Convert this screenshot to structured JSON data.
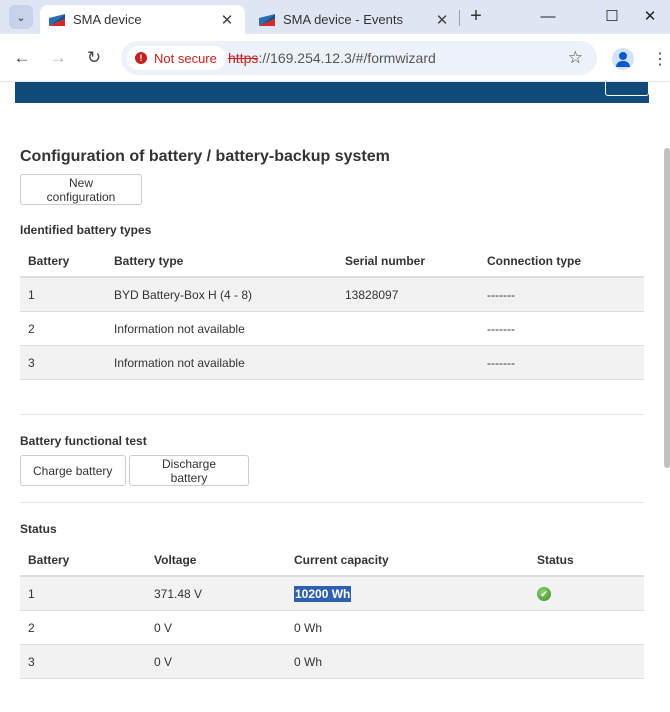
{
  "browser": {
    "tabs": [
      {
        "title": "SMA device",
        "active": true
      },
      {
        "title": "SMA device - Events",
        "active": false
      }
    ],
    "address": {
      "security_label": "Not secure",
      "url_scheme": "https",
      "url_rest": "://169.254.12.3/#/formwizard"
    }
  },
  "page": {
    "title": "Configuration of battery / battery-backup system",
    "new_config_label": "New configuration",
    "identified": {
      "heading": "Identified battery types",
      "columns": [
        "Battery",
        "Battery type",
        "Serial number",
        "Connection type"
      ],
      "rows": [
        {
          "battery": "1",
          "type": "BYD Battery-Box H (4 - 8)",
          "serial": "13828097",
          "connection": "-------"
        },
        {
          "battery": "2",
          "type": "Information not available",
          "serial": "",
          "connection": "-------"
        },
        {
          "battery": "3",
          "type": "Information not available",
          "serial": "",
          "connection": "-------"
        }
      ]
    },
    "functional_test": {
      "heading": "Battery functional test",
      "charge_label": "Charge battery",
      "discharge_label": "Discharge battery"
    },
    "status": {
      "heading": "Status",
      "columns": [
        "Battery",
        "Voltage",
        "Current capacity",
        "Status"
      ],
      "rows": [
        {
          "battery": "1",
          "voltage": "371.48 V",
          "capacity": "10200 Wh",
          "status_icon": "ok-check-icon"
        },
        {
          "battery": "2",
          "voltage": "0 V",
          "capacity": "0 Wh",
          "status_icon": ""
        },
        {
          "battery": "3",
          "voltage": "0 V",
          "capacity": "0 Wh",
          "status_icon": ""
        }
      ]
    }
  },
  "colors": {
    "brand_header": "#0f4a78",
    "status_ok": "#3a8c2a",
    "selection": "#2f5faf"
  }
}
